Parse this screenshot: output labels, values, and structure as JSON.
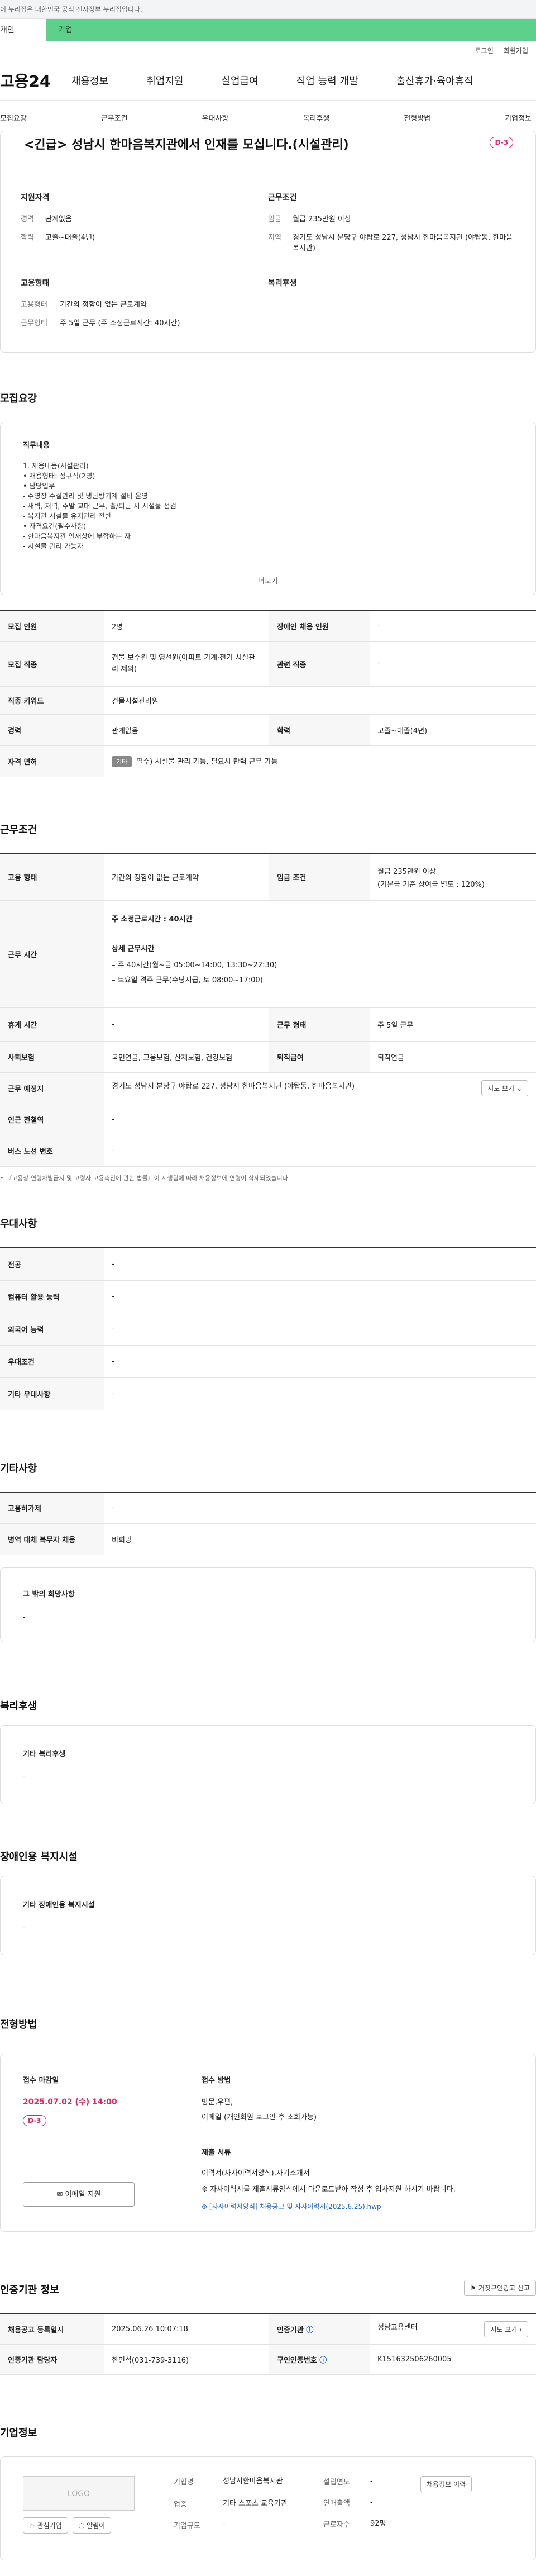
{
  "gov_banner": "이 누리집은 대한민국 공식 전자정부 누리집입니다.",
  "target_tabs": [
    "개인",
    "기업"
  ],
  "util": [
    "로그인",
    "회원가입"
  ],
  "logo": "고용24",
  "gnb": [
    "채용정보",
    "취업지원",
    "실업급여",
    "직업 능력 개발",
    "출산휴가·육아휴직"
  ],
  "subnav": [
    "모집요강",
    "근무조건",
    "우대사항",
    "복리후생",
    "전형방법",
    "기업정보"
  ],
  "summary": {
    "title": "<긴급> 성남시 한마음복지관에서 인재를 모십니다.(시설관리)",
    "dday": "D-3",
    "qual_h": "지원자격",
    "career_k": "경력",
    "career_v": "관계없음",
    "edu_k": "학력",
    "edu_v": "고졸~대졸(4년)",
    "cond_h": "근무조건",
    "wage_k": "임금",
    "wage_v": "월급 235만원 이상",
    "area_k": "지역",
    "area_v": "경기도 성남시 분당구 야탑로 227, 성남시 한마음복지관 (야탑동, 한마음복지관)",
    "emp_h": "고용형태",
    "type_k": "고용형태",
    "type_v": "기간의 정함이 없는 근로계약",
    "hours_k": "근무형태",
    "hours_v": "주 5일 근무 (주 소정근로시간: 40시간)",
    "welfare_h": "복리후생"
  },
  "recruit": {
    "title": "모집요강",
    "duty_label": "직무내용",
    "duty_lines": [
      "1. 채용내용(시설관리)",
      "• 채용형태: 정규직(2명)",
      "• 담당업무",
      "- 수영장 수질관리 및 냉난방기계 설비 운영",
      "- 새벽, 저녁, 주말 교대 근무, 출/퇴근 시 시설물 점검",
      "- 복지관 시설물 유지관리 전반",
      "• 자격요건(필수사항)",
      "- 한마음복지관 인재상에 부합하는 자",
      "- 시설물 관리 가능자"
    ],
    "more": "더보기",
    "rows": [
      {
        "h1": "모집 인원",
        "v1": "2명",
        "h2": "장애인 채용 인원",
        "v2": "-"
      },
      {
        "h1": "모집 직종",
        "v1": "건물 보수원 및 영선원(아파트 기계·전기 시설관리 제외)",
        "h2": "관련 직종",
        "v2": "-"
      },
      {
        "h1": "직종 키워드",
        "v1": "건물시설관리원"
      },
      {
        "h1": "경력",
        "v1": "관계없음",
        "h2": "학력",
        "v2": "고졸~대졸(4년)"
      }
    ],
    "license_h": "자격 면허",
    "license_tag": "기타",
    "license_v": "필수) 시설물 관리 가능, 필요시 탄력 근무 가능"
  },
  "work": {
    "title": "근무조건",
    "type_h": "고용 형태",
    "type_v": "기간의 정함이 없는 근로계약",
    "wage_h": "임금 조건",
    "wage_v1": "월급 235만원 이상",
    "wage_v2": "(기본급 기준 상여금 별도 : 120%)",
    "time_h": "근무 시간",
    "time_base": "주 소정근로시간 :",
    "time_base_v": "40시간",
    "time_detail_h": "상세 근무시간",
    "time_detail_1": "– 주 40시간(월~금 05:00~14:00, 13:30~22:30)",
    "time_detail_2": "– 토요일 격주 근무(수당지급, 토 08:00~17:00)",
    "rest_h": "휴게 시간",
    "rest_v": "-",
    "form_h": "근무 형태",
    "form_v": "주 5일 근무",
    "ins_h": "사회보험",
    "ins_v": "국민연금, 고용보험, 산재보험, 건강보험",
    "sev_h": "퇴직급여",
    "sev_v": "퇴직연금",
    "place_h": "근무 예정지",
    "place_v": "경기도 성남시 분당구 야탑로 227, 성남시 한마음복지관 (야탑동, 한마음복지관)",
    "map_btn": "지도 보기",
    "station_h": "인근 전철역",
    "station_v": "-",
    "bus_h": "버스 노선 번호",
    "bus_v": "-",
    "note": "• 『고용상 연령차별금지 및 고령자 고용촉진에 관한 법률』이 시행됨에 따라 채용정보에 연령이 삭제되었습니다."
  },
  "pref": {
    "title": "우대사항",
    "rows": [
      {
        "h": "전공",
        "v": "-"
      },
      {
        "h": "컴퓨터 활용 능력",
        "v": "-"
      },
      {
        "h": "외국어 능력",
        "v": "-"
      },
      {
        "h": "우대조건",
        "v": "-"
      },
      {
        "h": "기타 우대사항",
        "v": "-"
      }
    ]
  },
  "etc": {
    "title": "기타사항",
    "rows": [
      {
        "h": "고용허가제",
        "v": "-"
      },
      {
        "h": "병역 대체 복무자 채용",
        "v": "비희망"
      }
    ],
    "other_h": "그 밖의 희망사항",
    "other_v": "-"
  },
  "welfare": {
    "title": "복리후생",
    "box_h": "기타 복리후생",
    "box_v": "-"
  },
  "disabled": {
    "title": "장애인용 복지시설",
    "box_h": "기타 장애인용 복지시설",
    "box_v": "-"
  },
  "selection": {
    "title": "전형방법",
    "deadline_h": "접수 마감일",
    "deadline_v": "2025.07.02 (수) 14:00",
    "dday": "D-3",
    "email_btn": "이메일 지원",
    "method_h": "접수 방법",
    "method_v1": "방문,우편,",
    "method_v2": "이메일 (개인회원 로그인 후 조회가능)",
    "docs_h": "제출 서류",
    "docs_v1": "이력서(자사이력서양식),자기소개서",
    "docs_v2": "※ 자사이력서를 제출서류양식에서 다운로드받아 작성 후 입사지원 하시기 바랍니다.",
    "file": "[자사이력서양식] 채용공고 및 자사이력서(2025.6.25).hwp"
  },
  "cert": {
    "title": "인증기관 정보",
    "report_btn": "거짓구인광고 신고",
    "reg_h": "채용공고 등록일시",
    "reg_v": "2025.06.26 10:07:18",
    "org_h": "인증기관",
    "org_v": "성남고용센터",
    "map_btn": "지도 보기",
    "staff_h": "인증기관 담당자",
    "staff_v": "한민석(031-739-3116)",
    "no_h": "구인인증번호",
    "no_v": "K151632506260005"
  },
  "company": {
    "title": "기업정보",
    "logo": "LOGO",
    "fav_btn": "관심기업",
    "alarm_btn": "알림이",
    "name_k": "기업명",
    "name_v": "성남시한마음복지관",
    "biz_k": "업종",
    "biz_v": "기타 스포츠 교육기관",
    "size_k": "기업규모",
    "size_v": "-",
    "year_k": "설립연도",
    "year_v": "-",
    "sales_k": "연매출액",
    "sales_v": "-",
    "emp_k": "근로자수",
    "emp_v": "92명",
    "jobs_btn": "채용정보 이력"
  },
  "colors": {
    "accent": "#e0245e",
    "green": "#5dd18b",
    "link": "#1a63c4"
  }
}
